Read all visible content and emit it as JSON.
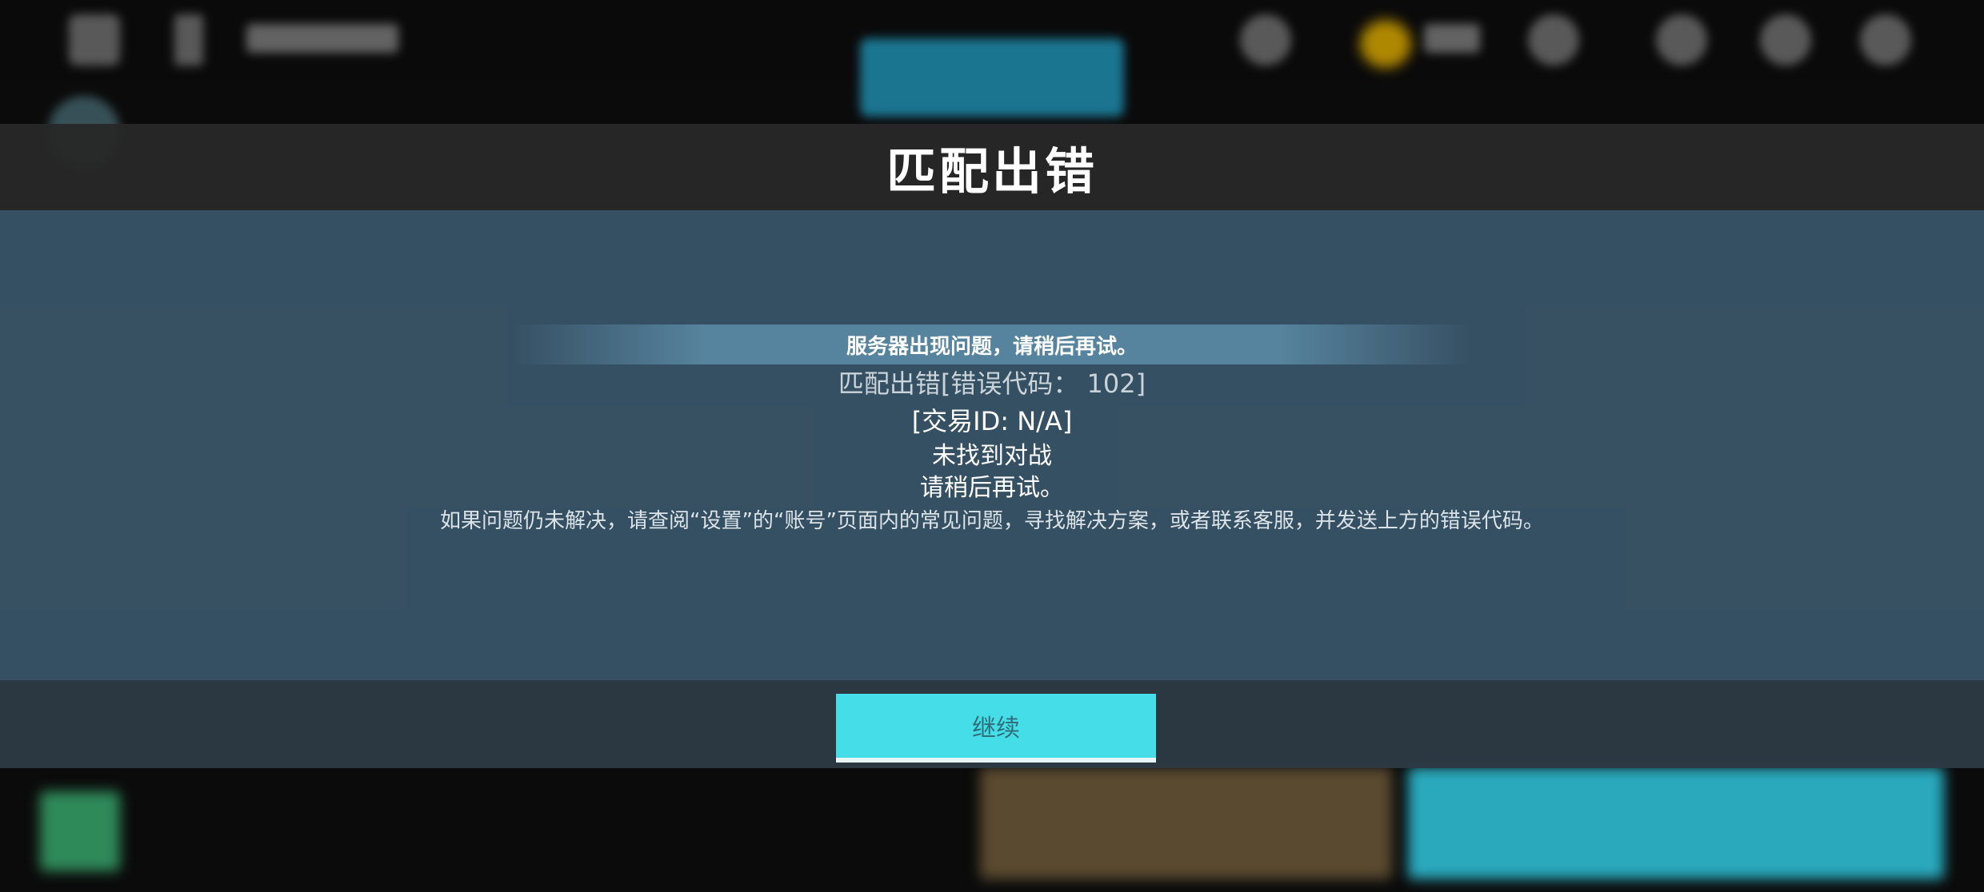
{
  "dialog": {
    "title": "匹配出错",
    "banner": "服务器出现问题，请稍后再试。",
    "error_code_line": "匹配出错[错误代码： 102]",
    "transaction_line": "[交易ID: N/A]",
    "not_found_line": "未找到对战",
    "retry_line": "请稍后再试。",
    "help_line": "如果问题仍未解决，请查阅“设置”的“账号”页面内的常见问题，寻找解决方案，或者联系客服，并发送上方的错误代码。",
    "continue_label": "继续"
  },
  "colors": {
    "accent_button": "#45dde8",
    "panel": "#3a566a",
    "title_bar": "#282828"
  }
}
